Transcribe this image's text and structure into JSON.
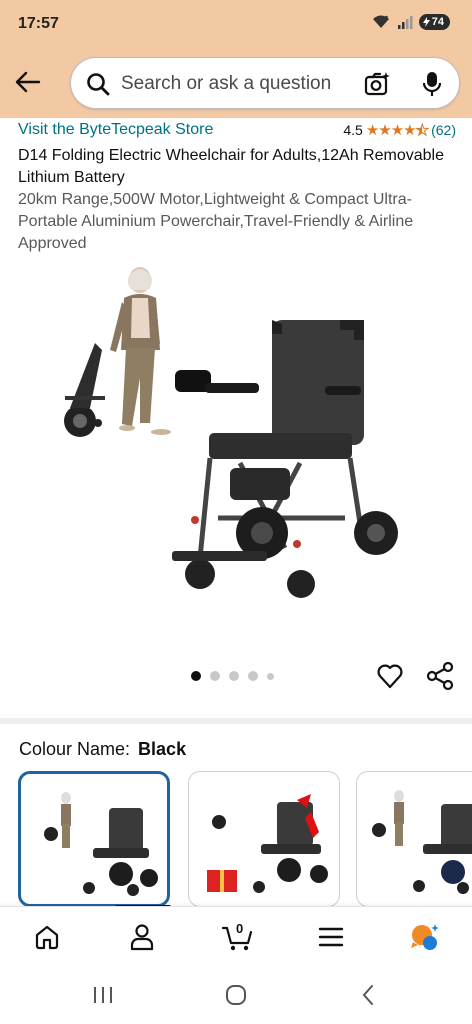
{
  "status_bar": {
    "time": "17:57",
    "battery": "74"
  },
  "search": {
    "placeholder": "Search or ask a question"
  },
  "product": {
    "store_link": "Visit the ByteTecpeak Store",
    "rating_value": "4.5",
    "rating_stars": 4.5,
    "rating_count": "(62)",
    "title_main": "D14 Folding Electric Wheelchair for Adults,12Ah Removable Lithium Battery",
    "title_rest": "20km Range,500W Motor,Lightweight & Compact Ultra-Portable Aluminium Powerchair,Travel-Friendly & Airline Approved",
    "image_count": 5,
    "image_index": 1
  },
  "colour": {
    "label": "Colour Name:",
    "value": "Black"
  },
  "bottom_nav": {
    "cart_count": "0"
  },
  "colors": {
    "header": "#f2c9a3",
    "link": "#007185",
    "star": "#de7921",
    "selected_border": "#2162a1"
  },
  "icons": [
    "back-arrow-icon",
    "search-icon",
    "camera-lens-icon",
    "mic-icon",
    "heart-icon",
    "share-icon",
    "home-icon",
    "account-icon",
    "cart-icon",
    "menu-icon",
    "ai-assistant-icon",
    "recent-apps-icon",
    "home-circle-icon",
    "back-chevron-icon"
  ]
}
